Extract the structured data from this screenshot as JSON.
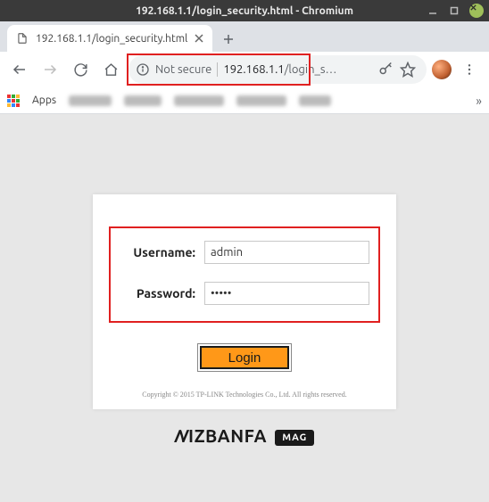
{
  "window": {
    "title": "192.168.1.1/login_security.html - Chromium"
  },
  "tab": {
    "title": "192.168.1.1/login_security.html"
  },
  "omnibox": {
    "security_label": "Not secure",
    "host": "192.168.1.1",
    "path": "/login_s…"
  },
  "bookmarks": {
    "apps_label": "Apps"
  },
  "login": {
    "username_label": "Username:",
    "password_label": "Password:",
    "username_value": "admin",
    "password_value": "•••••",
    "button_label": "Login",
    "copyright": "Copyright © 2015 TP-LINK Technologies Co., Ltd. All rights reserved."
  },
  "footer": {
    "brand_pre": "N",
    "brand_main": "IZBANFA",
    "brand_tag": "MAG"
  }
}
